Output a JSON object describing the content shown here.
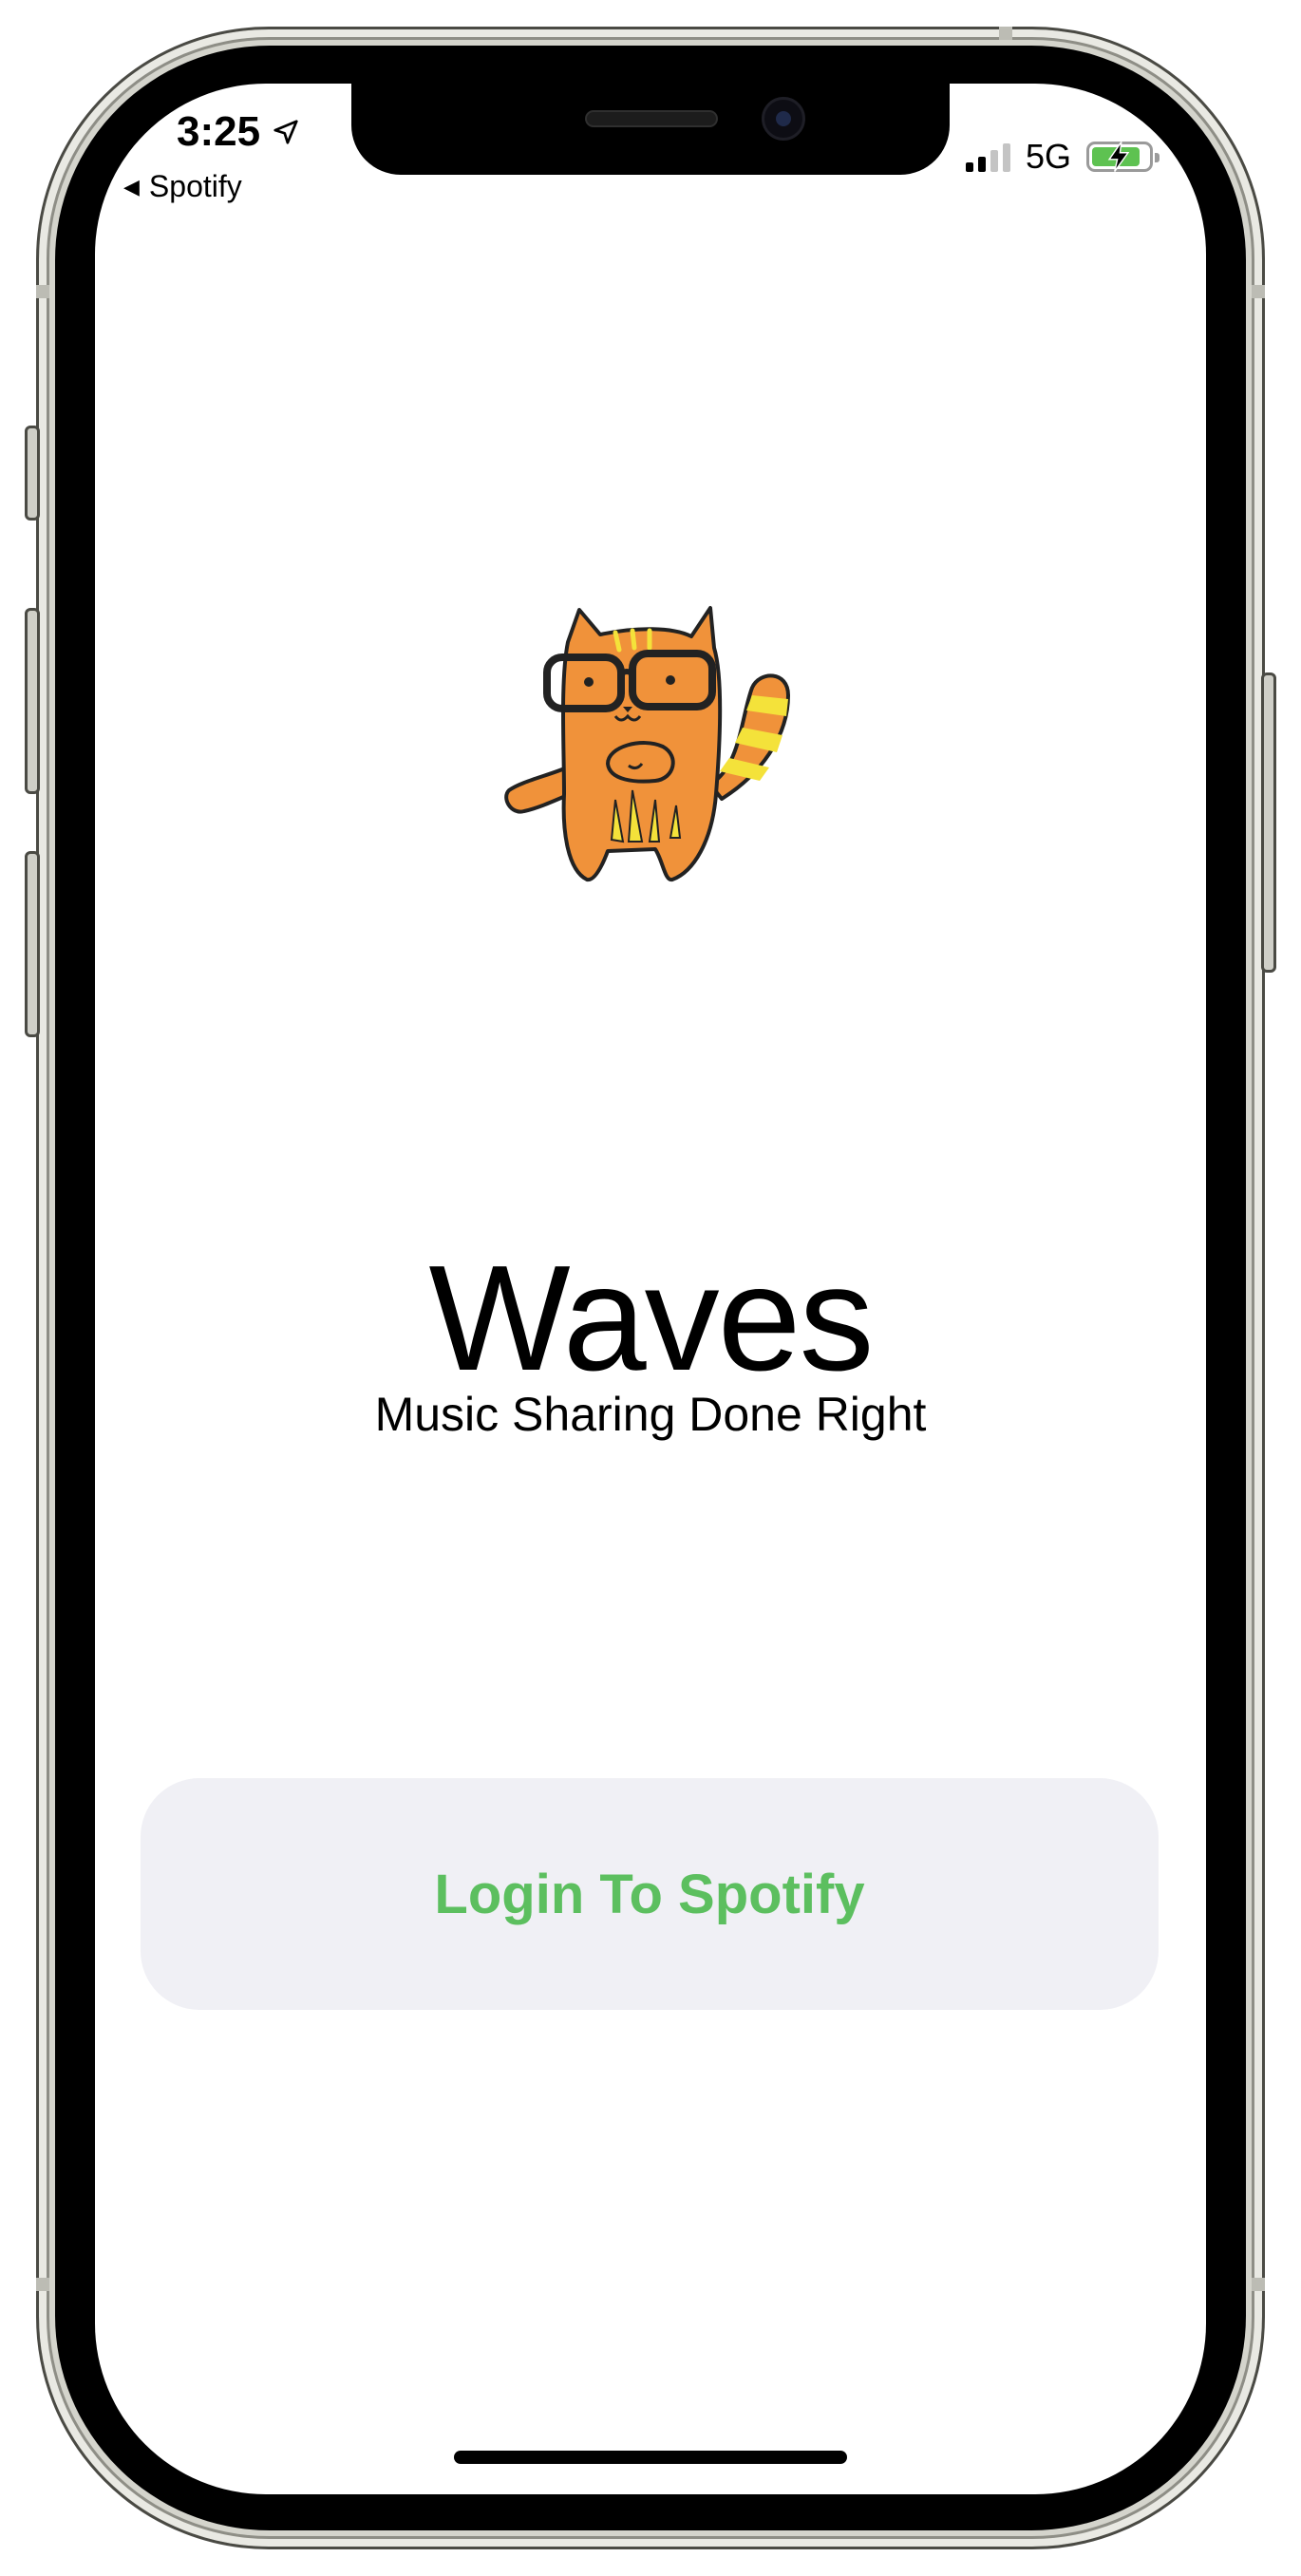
{
  "status_bar": {
    "time": "3:25",
    "back_app": "Spotify",
    "network": "5G"
  },
  "app": {
    "title": "Waves",
    "subtitle": "Music Sharing Done Right",
    "mascot": "cat-with-glasses-icon"
  },
  "login_button": {
    "label": "Login To Spotify"
  },
  "colors": {
    "accent_green": "#5cbf5f",
    "button_bg": "#f0f0f5",
    "battery_green": "#5ec251",
    "mascot_orange": "#f0923a"
  }
}
